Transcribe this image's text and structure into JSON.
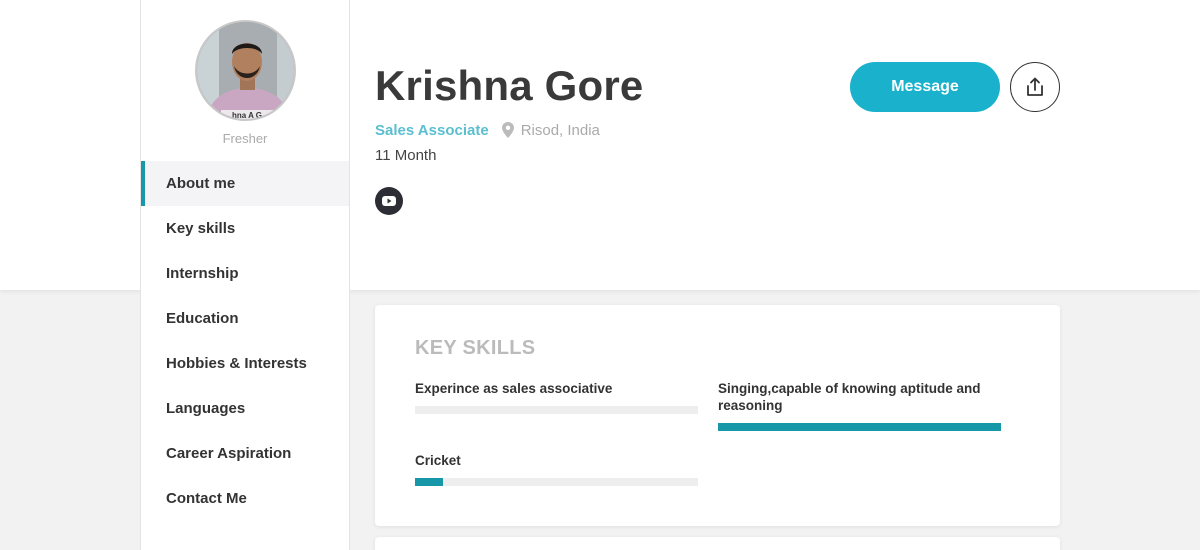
{
  "profile": {
    "name": "Krishna Gore",
    "role": "Sales Associate",
    "location": "Risod, India",
    "experience": "11 Month",
    "level": "Fresher",
    "avatar_caption": "hna A G"
  },
  "actions": {
    "message_label": "Message",
    "share_icon": "share-upload-icon",
    "youtube_icon": "youtube-icon"
  },
  "nav": {
    "items": [
      {
        "label": "About me",
        "active": true
      },
      {
        "label": "Key skills"
      },
      {
        "label": "Internship"
      },
      {
        "label": "Education"
      },
      {
        "label": "Hobbies & Interests"
      },
      {
        "label": "Languages"
      },
      {
        "label": "Career Aspiration"
      },
      {
        "label": "Contact Me"
      }
    ]
  },
  "skills_card": {
    "title": "KEY SKILLS",
    "skills": [
      {
        "name": "Experince as sales associative",
        "level": 0
      },
      {
        "name": "Singing,capable of knowing aptitude and reasoning",
        "level": 1.0
      },
      {
        "name": "Cricket",
        "level": 0.1
      }
    ]
  },
  "colors": {
    "accent": "#1798a8",
    "button": "#19b1cc",
    "role_text": "#5bbfd0"
  }
}
